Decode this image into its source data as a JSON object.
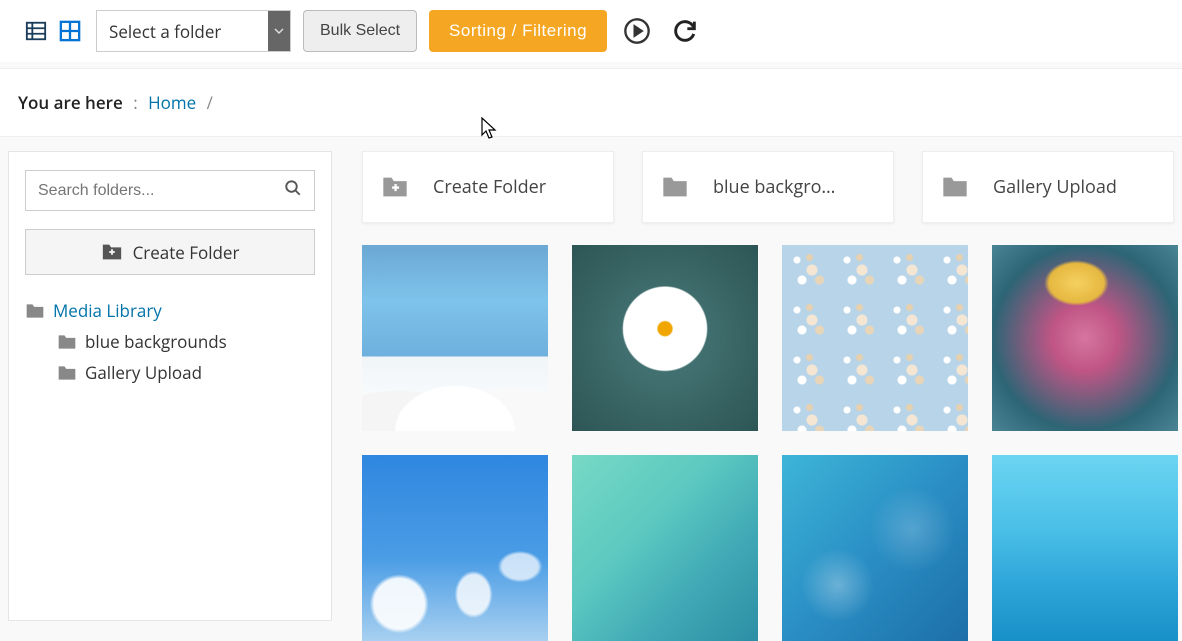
{
  "toolbar": {
    "folder_select_placeholder": "Select a folder",
    "bulk_select": "Bulk Select",
    "sorting_filtering": "Sorting / Filtering"
  },
  "breadcrumb": {
    "label": "You are here",
    "colon": ":",
    "home": "Home",
    "slash": "/"
  },
  "sidebar": {
    "search_placeholder": "Search folders...",
    "create_folder": "Create Folder",
    "tree": {
      "root": "Media Library",
      "children": [
        "blue backgrounds",
        "Gallery Upload"
      ]
    }
  },
  "main": {
    "cards": [
      {
        "label": "Create Folder",
        "kind": "create"
      },
      {
        "label": "blue backgro…",
        "kind": "folder"
      },
      {
        "label": "Gallery Upload",
        "kind": "folder"
      }
    ]
  }
}
